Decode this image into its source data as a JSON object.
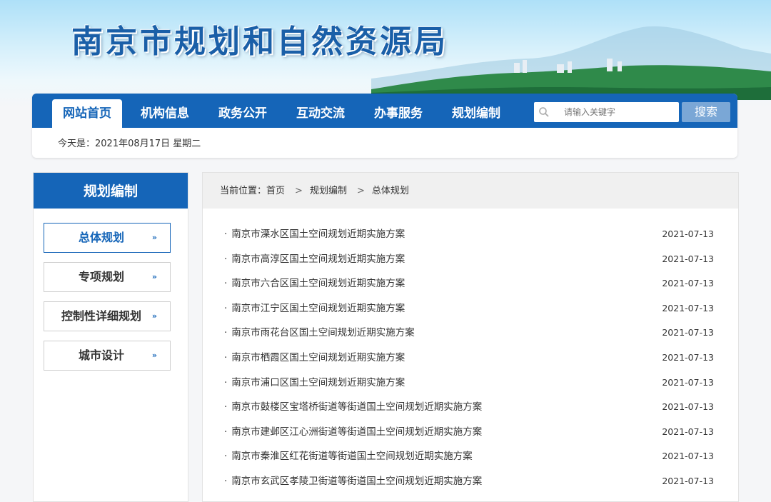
{
  "site_title": "南京市规划和自然资源局",
  "nav": {
    "items": [
      {
        "label": "网站首页",
        "active": true
      },
      {
        "label": "机构信息",
        "active": false
      },
      {
        "label": "政务公开",
        "active": false
      },
      {
        "label": "互动交流",
        "active": false
      },
      {
        "label": "办事服务",
        "active": false
      },
      {
        "label": "规划编制",
        "active": false
      }
    ],
    "search_placeholder": "请输入关键字",
    "search_button": "搜索"
  },
  "date_line": "今天是：2021年08月17日  星期二",
  "sidebar": {
    "title": "规划编制",
    "items": [
      {
        "label": "总体规划",
        "active": true
      },
      {
        "label": "专项规划",
        "active": false
      },
      {
        "label": "控制性详细规划",
        "active": false
      },
      {
        "label": "城市设计",
        "active": false
      }
    ],
    "arrow": "»"
  },
  "breadcrumb": {
    "prefix": "当前位置：",
    "home": "首页",
    "level1": "规划编制",
    "level2": "总体规划",
    "separator": ">"
  },
  "list": [
    {
      "title": "南京市溧水区国土空间规划近期实施方案",
      "date": "2021-07-13"
    },
    {
      "title": "南京市高淳区国土空间规划近期实施方案",
      "date": "2021-07-13"
    },
    {
      "title": "南京市六合区国土空间规划近期实施方案",
      "date": "2021-07-13"
    },
    {
      "title": "南京市江宁区国土空间规划近期实施方案",
      "date": "2021-07-13"
    },
    {
      "title": "南京市雨花台区国土空间规划近期实施方案",
      "date": "2021-07-13"
    },
    {
      "title": "南京市栖霞区国土空间规划近期实施方案",
      "date": "2021-07-13"
    },
    {
      "title": "南京市浦口区国土空间规划近期实施方案",
      "date": "2021-07-13"
    },
    {
      "title": "南京市鼓楼区宝塔桥街道等街道国土空间规划近期实施方案",
      "date": "2021-07-13"
    },
    {
      "title": "南京市建邺区江心洲街道等街道国土空间规划近期实施方案",
      "date": "2021-07-13"
    },
    {
      "title": "南京市秦淮区红花街道等街道国土空间规划近期实施方案",
      "date": "2021-07-13"
    },
    {
      "title": "南京市玄武区孝陵卫街道等街道国土空间规划近期实施方案",
      "date": "2021-07-13"
    }
  ],
  "colors": {
    "primary": "#1565b8",
    "search_button": "#7aa7d6"
  }
}
